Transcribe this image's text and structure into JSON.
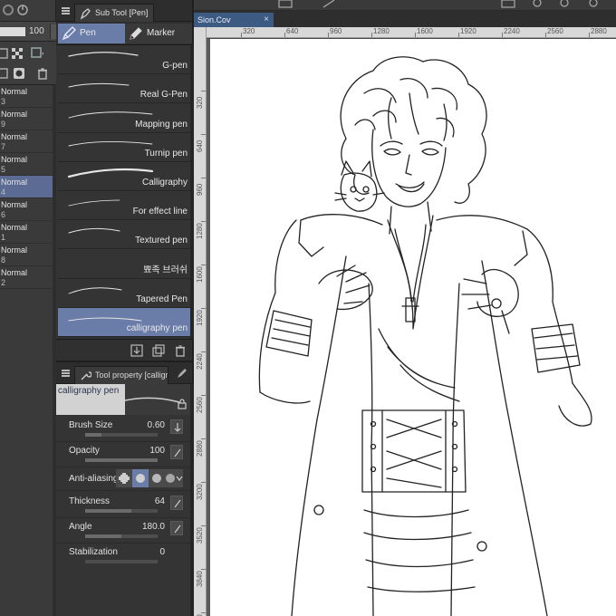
{
  "layers": {
    "opacity_value": "100",
    "items": [
      {
        "mode": "Normal",
        "num": "3"
      },
      {
        "mode": "Normal",
        "num": "9"
      },
      {
        "mode": "Normal",
        "num": "7"
      },
      {
        "mode": "Normal",
        "num": "5"
      },
      {
        "mode": "Normal",
        "num": "4"
      },
      {
        "mode": "Normal",
        "num": "6"
      },
      {
        "mode": "Normal",
        "num": "1"
      },
      {
        "mode": "Normal",
        "num": "8"
      },
      {
        "mode": "Normal",
        "num": "2"
      }
    ],
    "selected_index": 4
  },
  "subtool": {
    "tab_label": "Sub Tool [Pen]",
    "group_pen": "Pen",
    "group_marker": "Marker",
    "brushes": [
      "G-pen",
      "Real G-Pen",
      "Mapping pen",
      "Turnip pen",
      "Calligraphy",
      "For effect line",
      "Textured pen",
      "뾰족 브러쉬",
      "Tapered Pen",
      "calligraphy pen"
    ],
    "selected_brush": "calligraphy pen"
  },
  "toolprop": {
    "tab_label": "Tool property [calligraphy pen]",
    "preview_name": "calligraphy pen",
    "brush_size_label": "Brush Size",
    "brush_size_value": "0.60",
    "opacity_label": "Opacity",
    "opacity_value": "100",
    "antialias_label": "Anti-aliasing",
    "thickness_label": "Thickness",
    "thickness_value": "64",
    "angle_label": "Angle",
    "angle_value": "180.0",
    "stabilization_label": "Stabilization",
    "stabilization_value": "0"
  },
  "canvas": {
    "doc_tab": "Sion.Cov",
    "close_glyph": "×",
    "ruler_h": [
      "320",
      "640",
      "960",
      "1280",
      "1600",
      "1920",
      "2240",
      "2560",
      "2880"
    ],
    "ruler_v": [
      "320",
      "640",
      "960",
      "1280",
      "1600",
      "1920",
      "2240",
      "2560",
      "2880",
      "3200",
      "3520",
      "3840",
      "4160"
    ]
  },
  "colors": {
    "accent": "#6a7ca8",
    "panel": "#343434",
    "doc_tab": "#3d5a83",
    "paper": "#ffffff"
  },
  "icons": {
    "subtool_tab": "pen-nib-icon",
    "pen_group": "pen-icon",
    "marker_group": "marker-icon",
    "footer": [
      "import-icon",
      "duplicate-icon",
      "trash-icon"
    ],
    "prop_buttons": [
      "pressure-icon",
      "pressure-icon",
      "pressure-icon",
      "pressure-icon"
    ]
  }
}
